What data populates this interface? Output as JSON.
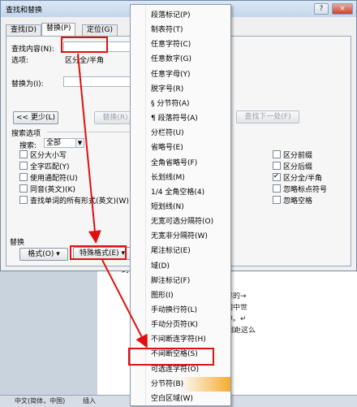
{
  "dialog": {
    "title": "查找和替换",
    "title_buttons": [
      "?",
      "×"
    ],
    "tabs": [
      {
        "label": "查找(D)"
      },
      {
        "label": "替换(P)"
      },
      {
        "label": "定位(G)"
      }
    ],
    "find_label": "查找内容(N):",
    "find_value": "",
    "options_label": "选项:",
    "options_value": "区分全/半角",
    "replace_label": "替换为(I):",
    "replace_value": "",
    "less_button": "<< 更少(L)",
    "replace_button": "替换(R)",
    "find_next_button": "查找下一处(F)",
    "search_options_title": "搜索选项",
    "search_label": "搜索:",
    "search_value": "全部",
    "left_checkboxes": [
      {
        "label": "区分大小写",
        "checked": false
      },
      {
        "label": "全字匹配(Y)",
        "checked": false
      },
      {
        "label": "使用通配符(U)",
        "checked": false
      },
      {
        "label": "同音(英文)(K)",
        "checked": false
      },
      {
        "label": "查找单词的所有形式(英文)(W)",
        "checked": false
      }
    ],
    "right_checkboxes": [
      {
        "label": "区分前缀",
        "checked": false
      },
      {
        "label": "区分后缀",
        "checked": false
      },
      {
        "label": "区分全/半角",
        "checked": true
      },
      {
        "label": "忽略标点符号",
        "checked": false
      },
      {
        "label": "忽略空格",
        "checked": false
      }
    ],
    "replace_section_title": "替换",
    "format_button": "格式(O) ▾",
    "special_button": "特殊格式(E) ▾"
  },
  "menu": {
    "items": [
      "段落标记(P)",
      "制表符(T)",
      "任意字符(C)",
      "任意数字(G)",
      "任意字母(Y)",
      "脱字号(R)",
      "§ 分节符(A)",
      "¶ 段落符号(A)",
      "分栏符(U)",
      "省略号(E)",
      "全角省略号(F)",
      "长划线(M)",
      "1/4 全角空格(4)",
      "短划线(N)",
      "无宽可选分隔符(O)",
      "无宽非分隔符(W)",
      "尾注标记(E)",
      "域(D)",
      "脚注标记(F)",
      "图形(I)",
      "手动换行符(L)",
      "手动分页符(K)",
      "不间断连字符(H)",
      "不间断空格(S)",
      "可选连字符(O)",
      "分节符(B)",
      "空白区域(W)"
    ],
    "highlighted_item": "分节符(B)"
  },
  "document": {
    "lines": [
      "的研究员准备前往中国南边的西部",
      "古文明考古地点都会找到同样的→",
      "耳朵相连的兔子图出现在英国中世",
      "纪到七世纪的中国隋朝唐宇中。↵",
      "思的是，为何时间和空间相距这么"
    ]
  },
  "statusbar": {
    "language": "中文(简体，中国)",
    "mode": "插入"
  },
  "colors": {
    "annotation": "#e01010",
    "titlebar": "#c4d6ec",
    "menu_highlight": "#f5ad30"
  }
}
